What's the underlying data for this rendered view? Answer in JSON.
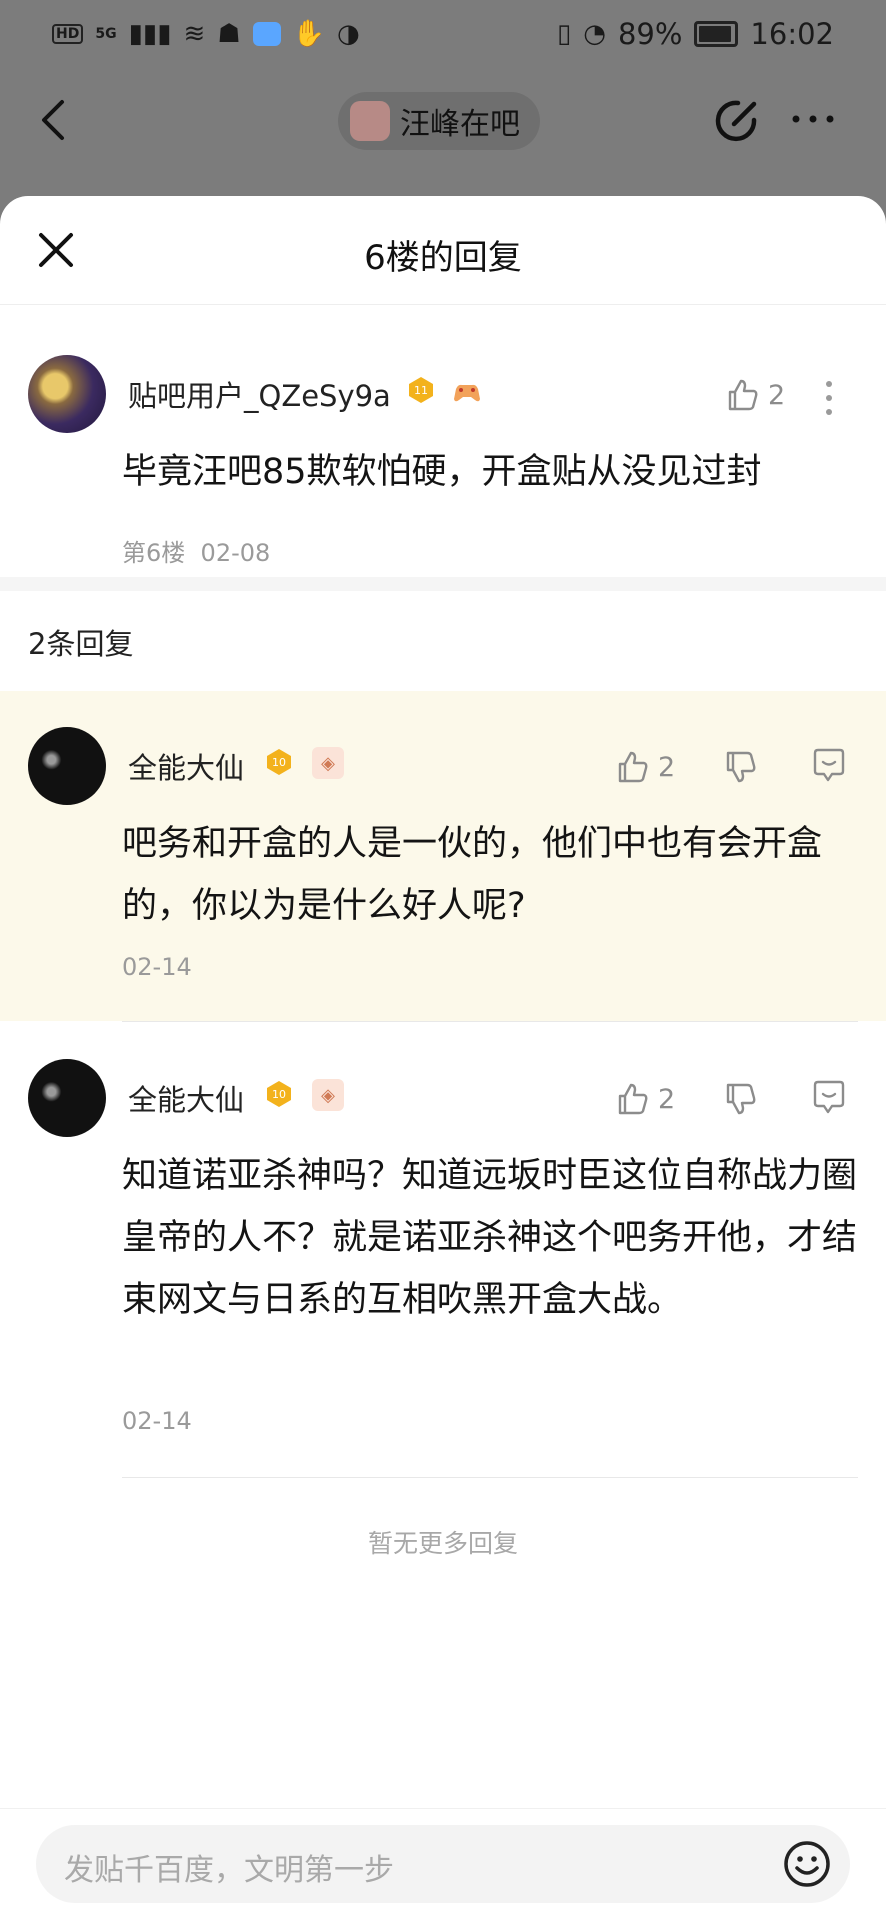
{
  "status_bar": {
    "battery": "89%",
    "time": "16:02",
    "network": "5G"
  },
  "topbar": {
    "forum_name": "汪峰在吧"
  },
  "sheet": {
    "title": "6楼的回复"
  },
  "post": {
    "username": "贴吧用户_QZeSy9a",
    "level": "11",
    "likes": "2",
    "content": "毕竟汪吧85欺软怕硬，开盒贴从没见过封",
    "floor": "第6楼",
    "date": "02-08"
  },
  "replies_count_label": "2条回复",
  "replies": [
    {
      "username": "全能大仙",
      "level": "10",
      "likes": "2",
      "content": "吧务和开盒的人是一伙的，他们中也有会开盒的，你以为是什么好人呢?",
      "date": "02-14"
    },
    {
      "username": "全能大仙",
      "level": "10",
      "likes": "2",
      "content": "知道诺亚杀神吗？知道远坂时臣这位自称战力圈皇帝的人不？就是诺亚杀神这个吧务开他，才结束网文与日系的互相吹黑开盒大战。",
      "date": "02-14"
    }
  ],
  "no_more_text": "暂无更多回复",
  "input": {
    "placeholder": "发贴千百度，文明第一步"
  },
  "colors": {
    "highlight_bg": "#fcf9ea",
    "level_gold": "#f3b21c",
    "muted_text": "#9a9a9a"
  }
}
